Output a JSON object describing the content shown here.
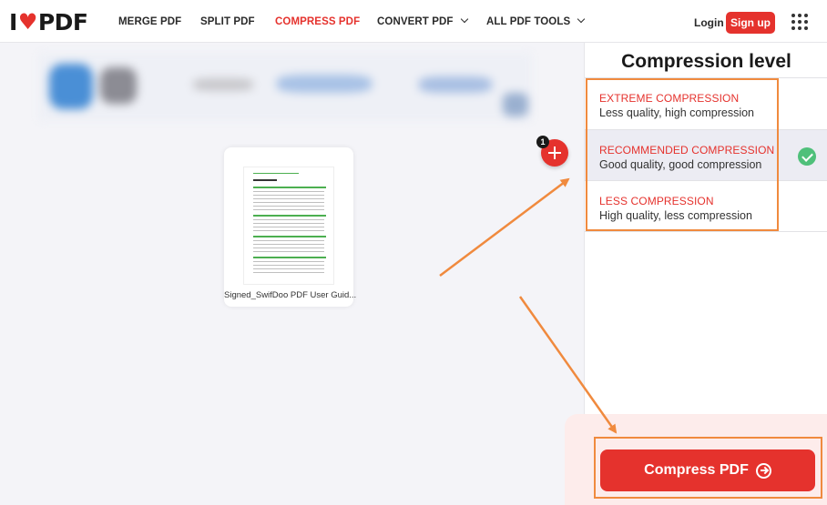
{
  "header": {
    "logo_left": "I",
    "logo_right": "PDF",
    "nav": [
      {
        "label": "MERGE PDF",
        "active": false
      },
      {
        "label": "SPLIT PDF",
        "active": false
      },
      {
        "label": "COMPRESS PDF",
        "active": true
      },
      {
        "label": "CONVERT PDF",
        "active": false,
        "dropdown": true
      },
      {
        "label": "ALL PDF TOOLS",
        "active": false,
        "dropdown": true
      }
    ],
    "login": "Login",
    "signup": "Sign up",
    "apps_icon": "grid-icon"
  },
  "main": {
    "file": {
      "name": "Signed_SwifDoo PDF User Guid..."
    },
    "file_count": "1"
  },
  "sidebar": {
    "title": "Compression level",
    "options": [
      {
        "title": "EXTREME COMPRESSION",
        "desc": "Less quality, high compression",
        "selected": false
      },
      {
        "title": "RECOMMENDED COMPRESSION",
        "desc": "Good quality, good compression",
        "selected": true
      },
      {
        "title": "LESS COMPRESSION",
        "desc": "High quality, less compression",
        "selected": false
      }
    ],
    "action": "Compress PDF"
  },
  "colors": {
    "brand": "#e5322d",
    "annotation": "#f08a3e",
    "check": "#4fc07a"
  }
}
